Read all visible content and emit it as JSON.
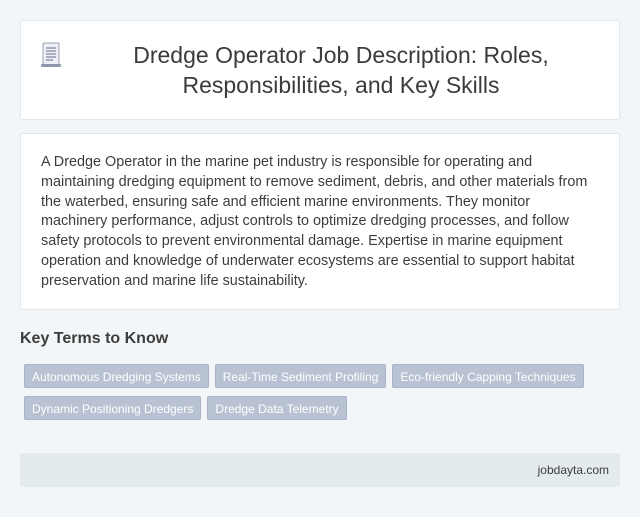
{
  "header": {
    "icon": "document-icon",
    "title": "Dredge Operator Job Description: Roles, Responsibilities, and Key Skills"
  },
  "description": "A Dredge Operator in the marine pet industry is responsible for operating and maintaining dredging equipment to remove sediment, debris, and other materials from the waterbed, ensuring safe and efficient marine environments. They monitor machinery performance, adjust controls to optimize dredging processes, and follow safety protocols to prevent environmental damage. Expertise in marine equipment operation and knowledge of underwater ecosystems are essential to support habitat preservation and marine life sustainability.",
  "key_terms": {
    "heading": "Key Terms to Know",
    "tags": [
      "Autonomous Dredging Systems",
      "Real-Time Sediment Profiling",
      "Eco-friendly Capping Techniques",
      "Dynamic Positioning Dredgers",
      "Dredge Data Telemetry"
    ]
  },
  "footer": {
    "site": "jobdayta.com"
  },
  "colors": {
    "background": "#f3f6f8",
    "card": "#ffffff",
    "tag": "#b9c2d3",
    "footer": "#e4ebee",
    "text": "#3d3d3d"
  }
}
